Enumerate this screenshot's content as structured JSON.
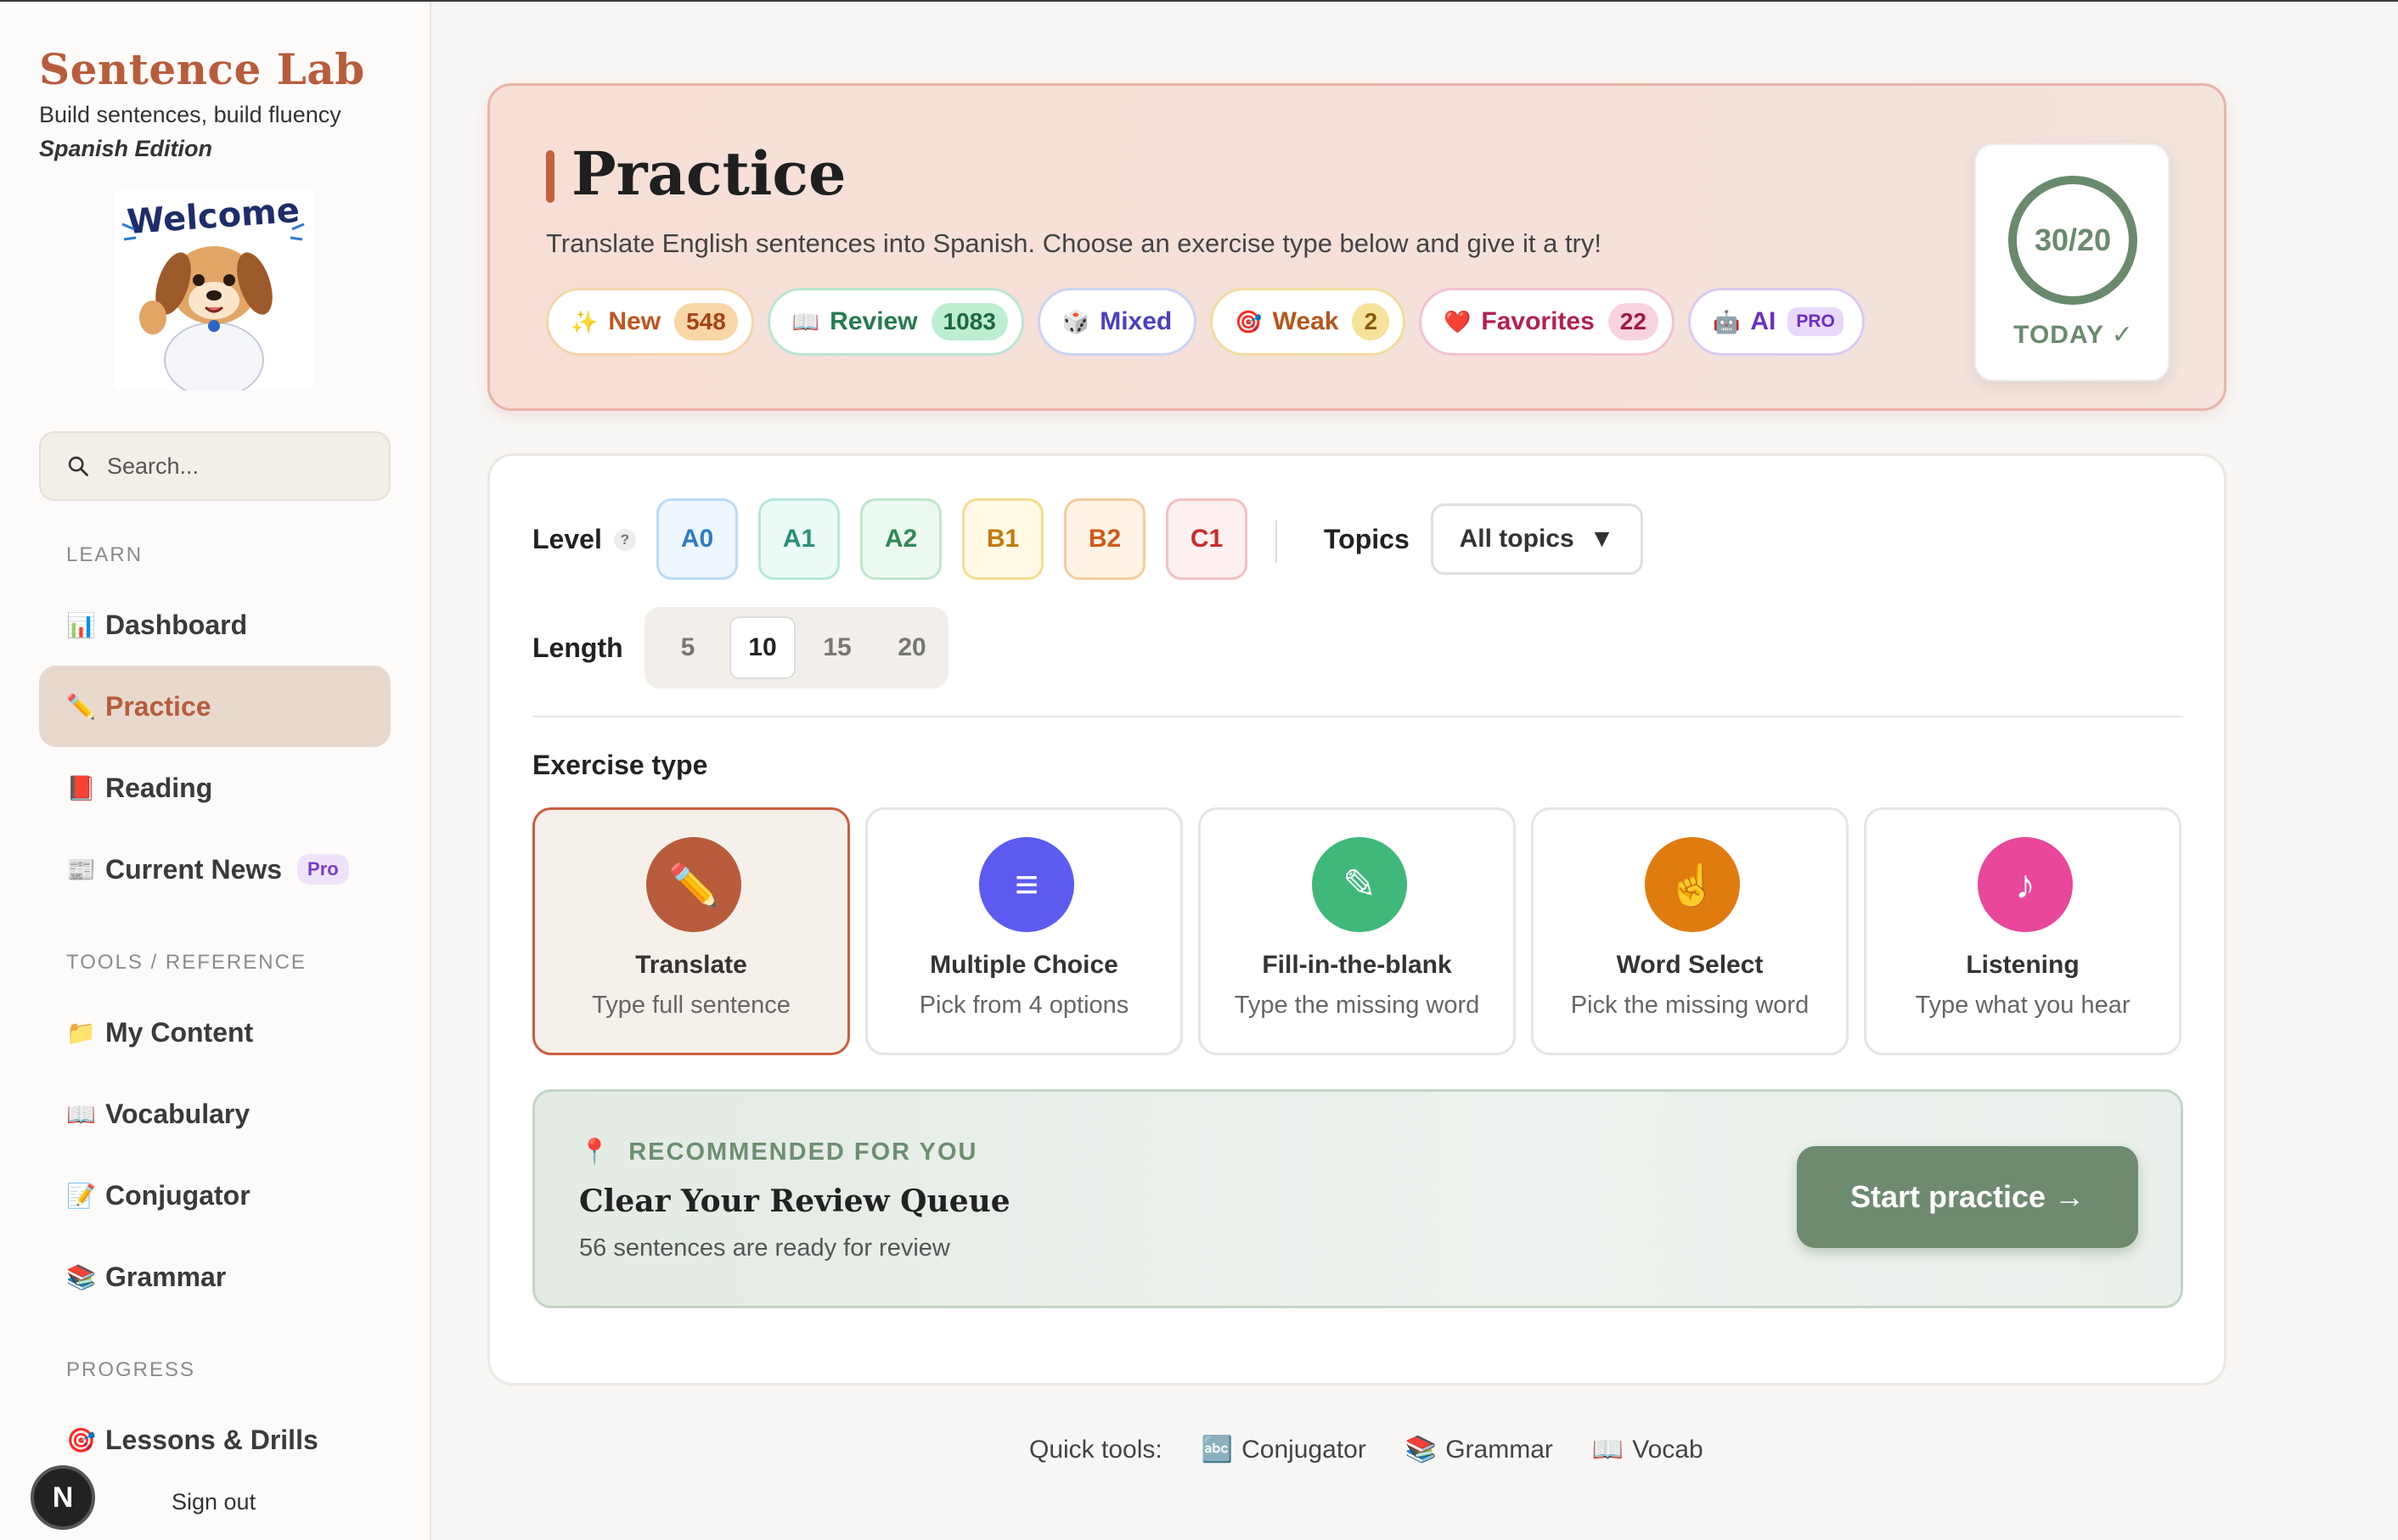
{
  "brand": {
    "title": "Sentence Lab",
    "subtitle": "Build sentences, build fluency",
    "edition": "Spanish Edition"
  },
  "search": {
    "placeholder": "Search..."
  },
  "sidebar": {
    "sections": {
      "learn": "LEARN",
      "tools": "TOOLS / REFERENCE",
      "progress": "PROGRESS"
    },
    "items": [
      {
        "label": "Dashboard",
        "icon": "📊"
      },
      {
        "label": "Practice",
        "icon": "✏️"
      },
      {
        "label": "Reading",
        "icon": "📕"
      },
      {
        "label": "Current News",
        "icon": "📰",
        "badge": "Pro"
      },
      {
        "label": "My Content",
        "icon": "📁"
      },
      {
        "label": "Vocabulary",
        "icon": "📖"
      },
      {
        "label": "Conjugator",
        "icon": "📝"
      },
      {
        "label": "Grammar",
        "icon": "📚"
      },
      {
        "label": "Lessons & Drills",
        "icon": "🎯"
      }
    ],
    "user_initial": "N",
    "sign_out": "Sign out"
  },
  "hero": {
    "title": "Practice",
    "subtitle": "Translate English sentences into Spanish. Choose an exercise type below and give it a try!",
    "pills": {
      "new": {
        "icon": "✨",
        "label": "New",
        "count": "548"
      },
      "review": {
        "icon": "📖",
        "label": "Review",
        "count": "1083"
      },
      "mixed": {
        "icon": "🎲",
        "label": "Mixed"
      },
      "weak": {
        "icon": "🎯",
        "label": "Weak",
        "count": "2"
      },
      "favorites": {
        "icon": "❤️",
        "label": "Favorites",
        "count": "22"
      },
      "ai": {
        "icon": "🤖",
        "label": "AI",
        "badge": "PRO"
      }
    },
    "today": {
      "value": "30/20",
      "label": "TODAY ✓",
      "progress": 1.0
    }
  },
  "filters": {
    "level_label": "Level",
    "help": "?",
    "levels": [
      "A0",
      "A1",
      "A2",
      "B1",
      "B2",
      "C1"
    ],
    "topics_label": "Topics",
    "topics_value": "All topics",
    "topics_caret": "▼",
    "length_label": "Length",
    "lengths": [
      "5",
      "10",
      "15",
      "20"
    ],
    "length_selected": "10"
  },
  "exercise": {
    "title": "Exercise type",
    "types": [
      {
        "name": "Translate",
        "desc": "Type full sentence",
        "icon": "✏️",
        "color": "#b85c3c"
      },
      {
        "name": "Multiple Choice",
        "desc": "Pick from 4 options",
        "icon": "≡",
        "color": "#5b5bf0"
      },
      {
        "name": "Fill-in-the-blank",
        "desc": "Type the missing word",
        "icon": "✎",
        "color": "#3fb879"
      },
      {
        "name": "Word Select",
        "desc": "Pick the missing word",
        "icon": "☝️",
        "color": "#e07b10"
      },
      {
        "name": "Listening",
        "desc": "Type what you hear",
        "icon": "♪",
        "color": "#e8479a"
      }
    ]
  },
  "recommendation": {
    "icon": "📍",
    "label": "RECOMMENDED FOR YOU",
    "title": "Clear Your Review Queue",
    "subtitle": "56 sentences are ready for review",
    "button": "Start practice →"
  },
  "quick_tools": {
    "label": "Quick tools:",
    "items": [
      {
        "icon": "🔤",
        "label": "Conjugator"
      },
      {
        "icon": "📚",
        "label": "Grammar"
      },
      {
        "icon": "📖",
        "label": "Vocab"
      }
    ]
  },
  "colors": {
    "accent": "#b85c3c",
    "green": "#6e8b6f"
  }
}
